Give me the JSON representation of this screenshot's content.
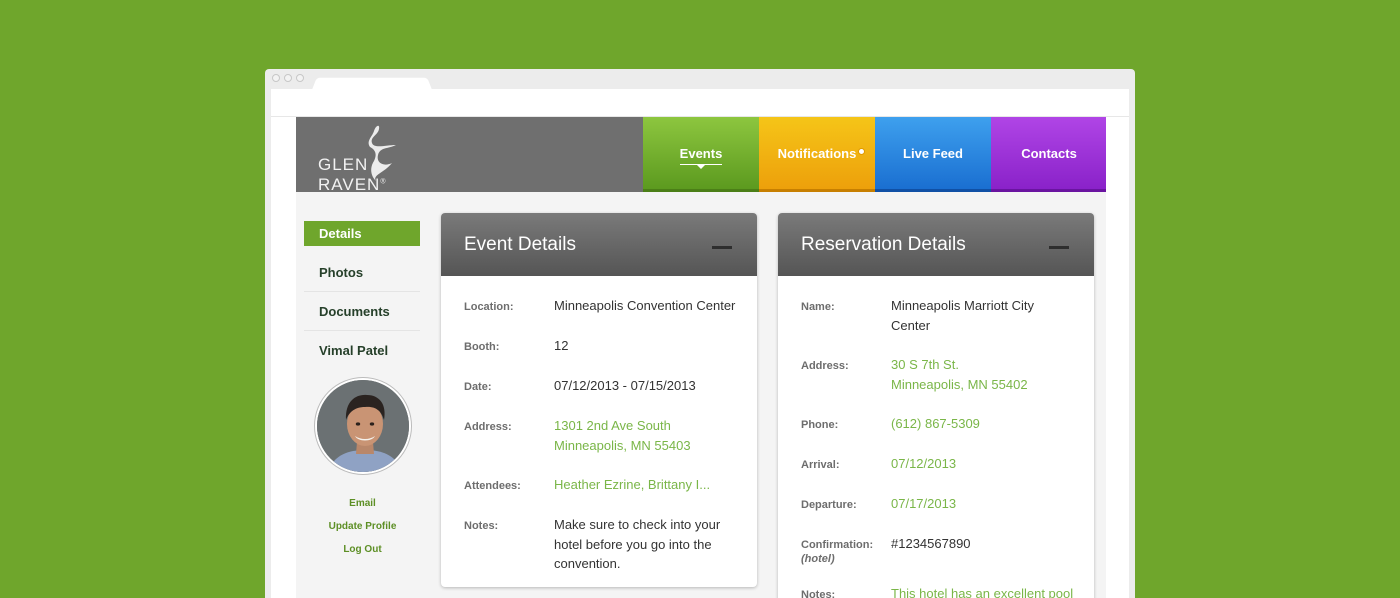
{
  "nav": {
    "events": "Events",
    "notifications": "Notifications",
    "live_feed": "Live Feed",
    "contacts": "Contacts"
  },
  "logo": {
    "text_left": "GLEN",
    "text_right": "RAVEN",
    "reg": "®"
  },
  "sidebar": {
    "items": [
      {
        "label": "Details"
      },
      {
        "label": "Photos"
      },
      {
        "label": "Documents"
      },
      {
        "label": "Vimal Patel"
      }
    ],
    "links": {
      "email": "Email",
      "update_profile": "Update Profile",
      "log_out": "Log Out"
    }
  },
  "event": {
    "title": "Event Details",
    "location_label": "Location:",
    "location": "Minneapolis Convention Center",
    "booth_label": "Booth:",
    "booth": "12",
    "date_label": "Date:",
    "date": "07/12/2013 - 07/15/2013",
    "address_label": "Address:",
    "address_line1": "1301 2nd Ave South",
    "address_line2": "Minneapolis, MN 55403",
    "attendees_label": "Attendees:",
    "attendees": "Heather Ezrine, Brittany I...",
    "notes_label": "Notes:",
    "notes": "Make sure to check into your hotel before you go into the convention."
  },
  "reservation": {
    "title": "Reservation Details",
    "name_label": "Name:",
    "name": "Minneapolis Marriott City Center",
    "address_label": "Address:",
    "address_line1": "30 S 7th St.",
    "address_line2": "Minneapolis, MN 55402",
    "phone_label": "Phone:",
    "phone": "(612) 867-5309",
    "arrival_label": "Arrival:",
    "arrival": "07/12/2013",
    "departure_label": "Departure:",
    "departure": "07/17/2013",
    "confirmation_label": "Confirmation:",
    "confirmation_sub": "(hotel)",
    "confirmation": "#1234567890",
    "notes_label": "Notes:",
    "notes": "This hotel has an excellent pool and gym. Make sure you"
  },
  "colors": {
    "background": "#6fa62c",
    "events": "#6fae2c",
    "notifications": "#f2b312",
    "live_feed": "#2a88e0",
    "contacts": "#9c33d8",
    "link_green": "#7ab648"
  }
}
